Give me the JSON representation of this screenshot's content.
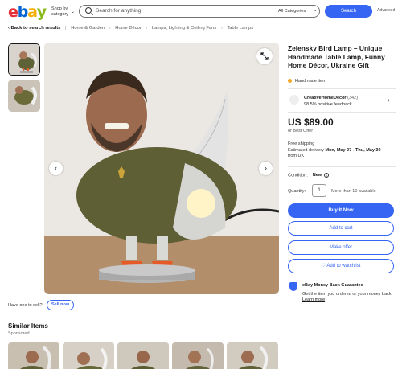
{
  "header": {
    "logo_letters": [
      {
        "ch": "e",
        "color": "#e53238"
      },
      {
        "ch": "b",
        "color": "#0064d2"
      },
      {
        "ch": "a",
        "color": "#f5af02"
      },
      {
        "ch": "y",
        "color": "#86b817"
      }
    ],
    "shop_by_label": "Shop by category",
    "search_placeholder": "Search for anything",
    "category_select": "All Categories",
    "search_button": "Search",
    "advanced_link": "Advanced"
  },
  "breadcrumb": {
    "back_label": "Back to search results",
    "items": [
      "Home & Garden",
      "Home Décor",
      "Lamps, Lighting & Ceiling Fans",
      "Table Lamps"
    ]
  },
  "listing": {
    "title": "Zelensky Bird Lamp – Unique Handmade Table Lamp, Funny Home Décor, Ukraine Gift",
    "handmade_label": "Handmade item",
    "seller_name": "CreativeHomeDecor",
    "seller_count": "(342)",
    "seller_feedback": "98.5% positive feedback",
    "price": "US $89.00",
    "best_offer": "or Best Offer",
    "shipping_line": "Free shipping",
    "delivery_prefix": "Estimated delivery",
    "delivery_dates": "Mon, May 27 - Thu, May 30",
    "delivery_from": "from UK",
    "condition_label": "Condition:",
    "condition_value": "New",
    "quantity_label": "Quantity:",
    "quantity_value": "1",
    "quantity_available": "More than 10 available",
    "buy_now": "Buy It Now",
    "add_to_cart": "Add to cart",
    "make_offer": "Make offer",
    "watchlist": "♡ Add to watchlist",
    "guarantee_title": "eBay Money Back Guarantee",
    "guarantee_text": "Get the item you ordered or your money back.",
    "learn_more": "Learn more"
  },
  "sell": {
    "prompt": "Have one to sell?",
    "button": "Sell now"
  },
  "similar": {
    "heading": "Similar Items",
    "sponsored": "Sponsored"
  },
  "icons": [
    "search-icon",
    "chevron-down-icon",
    "back-arrow-icon",
    "expand-icon",
    "chevron-left-icon",
    "chevron-right-icon",
    "info-icon",
    "money-back-shield-icon"
  ],
  "colors": {
    "accent": "#3665f3",
    "handmade_dot": "#f5a623"
  }
}
